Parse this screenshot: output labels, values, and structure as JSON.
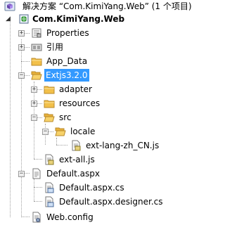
{
  "solution": {
    "label": "解决方案 “Com.KimiYang.Web” (1 个项目)",
    "icon": "solution-icon"
  },
  "project": {
    "label": "Com.KimiYang.Web",
    "icon": "web-project-icon",
    "expanded": true
  },
  "items": {
    "properties": {
      "label": "Properties",
      "icon": "properties-icon",
      "expanded": false
    },
    "references": {
      "label": "引用",
      "icon": "references-icon",
      "expanded": false
    },
    "app_data": {
      "label": "App_Data",
      "icon": "folder-icon"
    },
    "extjs": {
      "label": "Extjs3.2.0",
      "icon": "folder-open-icon",
      "expanded": true,
      "selected": true
    },
    "adapter": {
      "label": "adapter",
      "icon": "folder-icon",
      "expanded": false
    },
    "resources": {
      "label": "resources",
      "icon": "folder-icon",
      "expanded": false
    },
    "src": {
      "label": "src",
      "icon": "folder-open-icon",
      "expanded": true
    },
    "locale": {
      "label": "locale",
      "icon": "folder-open-icon",
      "expanded": true
    },
    "ext_lang": {
      "label": "ext-lang-zh_CN.js",
      "icon": "js-file-icon"
    },
    "ext_all": {
      "label": "ext-all.js",
      "icon": "js-file-icon"
    },
    "default_aspx": {
      "label": "Default.aspx",
      "icon": "aspx-file-icon",
      "expanded": true
    },
    "default_cs": {
      "label": "Default.aspx.cs",
      "icon": "cs-file-icon"
    },
    "default_designer": {
      "label": "Default.aspx.designer.cs",
      "icon": "cs-file-icon"
    },
    "web_config": {
      "label": "Web.config",
      "icon": "config-file-icon"
    }
  },
  "colors": {
    "selection": "#3399ff",
    "folder": "#f2c04a",
    "tree_lines": "#a0a0a0"
  }
}
